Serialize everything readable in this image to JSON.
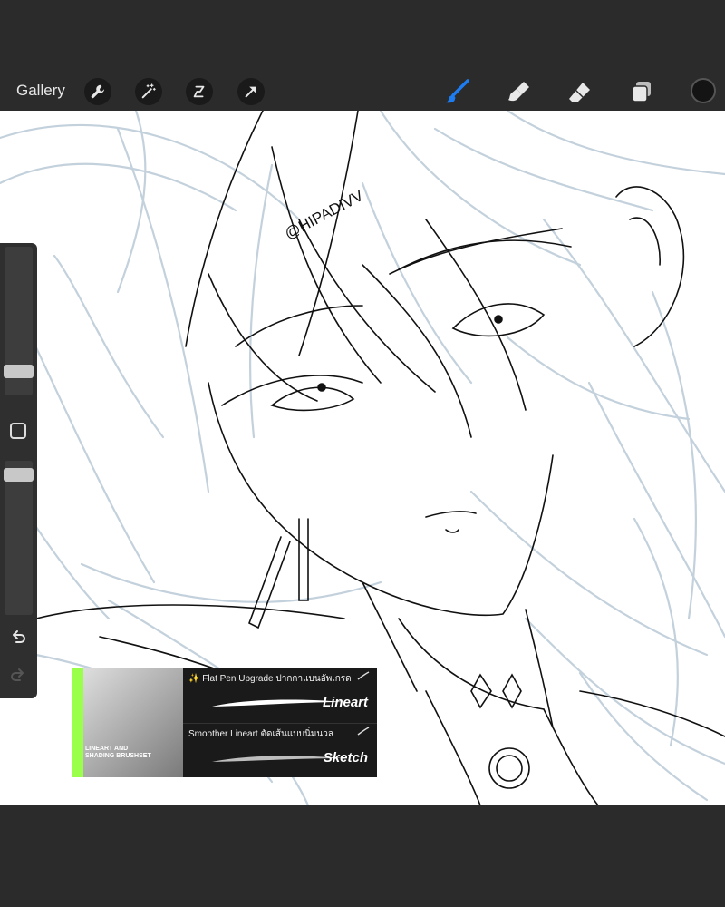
{
  "topbar": {
    "gallery_label": "Gallery",
    "left_tools": [
      "wrench-icon",
      "magic-wand-icon",
      "selection-icon",
      "transform-arrow-icon"
    ],
    "right_tools": [
      "brush-icon",
      "smudge-icon",
      "eraser-icon",
      "layers-icon"
    ],
    "accent_color": "#1e7cf2",
    "current_color": "#141414"
  },
  "canvas": {
    "watermark": "@HIPADIVV"
  },
  "sidebar": {
    "icons": [
      "modify-square-icon",
      "undo-icon",
      "redo-icon"
    ]
  },
  "promo": {
    "image_caption": "LINEART AND SHADING BRUSHSET",
    "items": [
      {
        "title": "✨ Flat Pen Upgrade ปากกาแบนอัพเกรด",
        "label": "Lineart"
      },
      {
        "title": "Smoother Lineart ตัดเส้นแบบนิ่มนวล",
        "label": "Sketch"
      }
    ]
  }
}
